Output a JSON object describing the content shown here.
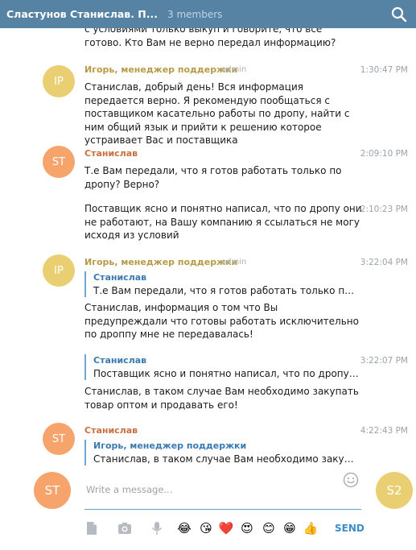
{
  "header": {
    "title": "Сластунов Станислав. П...",
    "members": "3 members"
  },
  "messages": [
    {
      "text": "с условиями только выкуп и говорите, что все готово. Кто Вам не верно передал информацию?"
    },
    {
      "avatar": "IP",
      "author": "Игорь, менеджер поддержки",
      "badge": "admin",
      "time": "1:30:47 PM",
      "text": "Станислав, добрый день! Вся информация передается верно. Я рекомендую пообщаться с поставщиком касательно работы по дропу, найти с ним общий язык и прийти к решению которое устраивает Вас и поставщика"
    },
    {
      "avatar": "ST",
      "author": "Станислав",
      "time": "2:09:10 PM",
      "text": "Т.е Вам передали, что я готов работать только по дропу? Верно?"
    },
    {
      "time": "2:10:23 PM",
      "text": "Поставщик ясно и понятно написал, что по дропу они не работают, на Вашу компанию я ссылаться не могу исходя из условий"
    },
    {
      "avatar": "IP",
      "author": "Игорь, менеджер поддержки",
      "badge": "admin",
      "time": "3:22:04 PM",
      "quote_name": "Станислав",
      "quote_text": "Т.е Вам передали, что я готов работать только по дропу? ...",
      "text": "Станислав, информация о том что Вы предупреждали что готовы работать исключительно по дроппу мне не передавалась!"
    },
    {
      "time": "3:22:07 PM",
      "quote_name": "Станислав",
      "quote_text": "Поставщик ясно и понятно написал, что по дропу они не р...",
      "text": "Станислав, в таком случае Вам необходимо закупать товар оптом и продавать его!"
    },
    {
      "avatar": "ST",
      "author": "Станислав",
      "time": "4:22:43 PM",
      "quote_name": "Игорь, менеджер поддержки",
      "quote_text": "Станислав, в таком случае Вам необходимо закупать товар"
    }
  ],
  "composer": {
    "placeholder": "Write a message...",
    "self_avatar": "ST",
    "peer_avatar": "S2",
    "send_label": "SEND",
    "stickers": [
      "😂",
      "😘",
      "❤️",
      "😍",
      "😊",
      "😁",
      "👍"
    ]
  },
  "colors": {
    "header_bg": "#5682a3",
    "admin_author": "#b79b47",
    "user_author": "#c7703e",
    "quote_bar": "#6fa6cf",
    "send": "#3d8ec9"
  }
}
